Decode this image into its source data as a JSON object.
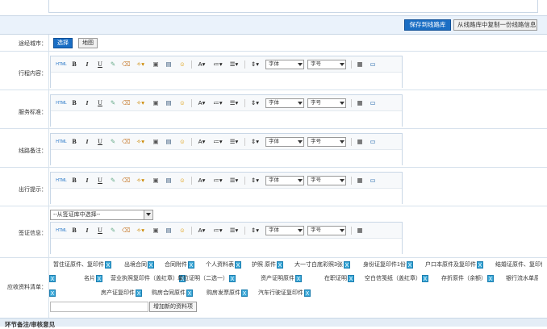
{
  "save_bar": {
    "save_label": "保存到线路库",
    "copy_label": "从线路库中复制一份线路信息"
  },
  "route_city": {
    "label": "途经城市：",
    "select_label": "选择",
    "map_label": "地图"
  },
  "editor_sections": [
    {
      "label": "行程内容："
    },
    {
      "label": "服务标准："
    },
    {
      "label": "线路备注："
    },
    {
      "label": "出行提示："
    }
  ],
  "toolbar": {
    "html": "HTML",
    "bold": "B",
    "italic": "I",
    "underline": "U",
    "font_size_btn": "A",
    "font_family": "字体",
    "font_size": "字号"
  },
  "visa": {
    "label": "签证信息：",
    "select_value": "--从签证库中选择--"
  },
  "documents": {
    "label": "应收资料清单：",
    "items": [
      "暂住证原件、复印件",
      "出境合同",
      "合同附件",
      "个人资料表",
      "护照 原件",
      "大一寸白底彩照3张",
      "身份证复印件1份",
      "户口本原件及复印件",
      "结婚证原件、复印件",
      "名片",
      "营业执照复印件（盖红章）",
      "单位证明（二选一）",
      "资产证明原件",
      "在职证明",
      "空白信笺纸（盖红章）",
      "存折原件（余额）",
      "银行流水单原件（余额）",
      "房产证复印件",
      "购房合同原件",
      "购房发票原件",
      "汽车行驶证复印件"
    ],
    "add_label": "增加新的资料项"
  },
  "footer": {
    "title": "环节备注/审核意见"
  }
}
